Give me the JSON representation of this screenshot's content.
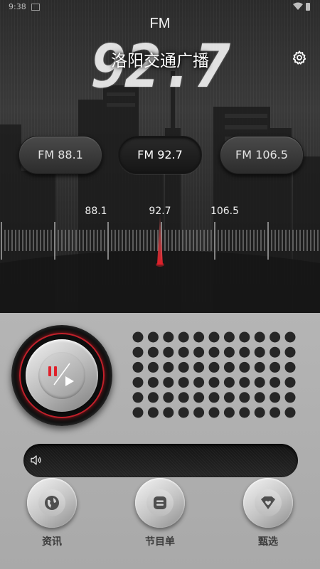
{
  "status_bar": {
    "time": "9:38"
  },
  "header": {
    "band": "FM",
    "frequency_display": "92.7",
    "station_name": "洛阳交通广播",
    "settings_icon": "gear-icon"
  },
  "presets": [
    {
      "label": "FM 88.1",
      "active": false
    },
    {
      "label": "FM 92.7",
      "active": true
    },
    {
      "label": "FM 106.5",
      "active": false
    }
  ],
  "tuner": {
    "scale_labels": [
      "88.1",
      "92.7",
      "106.5"
    ],
    "needle_color": "#e0202a"
  },
  "player": {
    "state_icon": "pause-play-icon",
    "ring_color": "#c0202a"
  },
  "volume": {
    "icon": "speaker-icon"
  },
  "bottom_nav": [
    {
      "label": "资讯",
      "icon": "globe-icon"
    },
    {
      "label": "节目单",
      "icon": "list-icon"
    },
    {
      "label": "甄选",
      "icon": "heart-icon"
    }
  ]
}
